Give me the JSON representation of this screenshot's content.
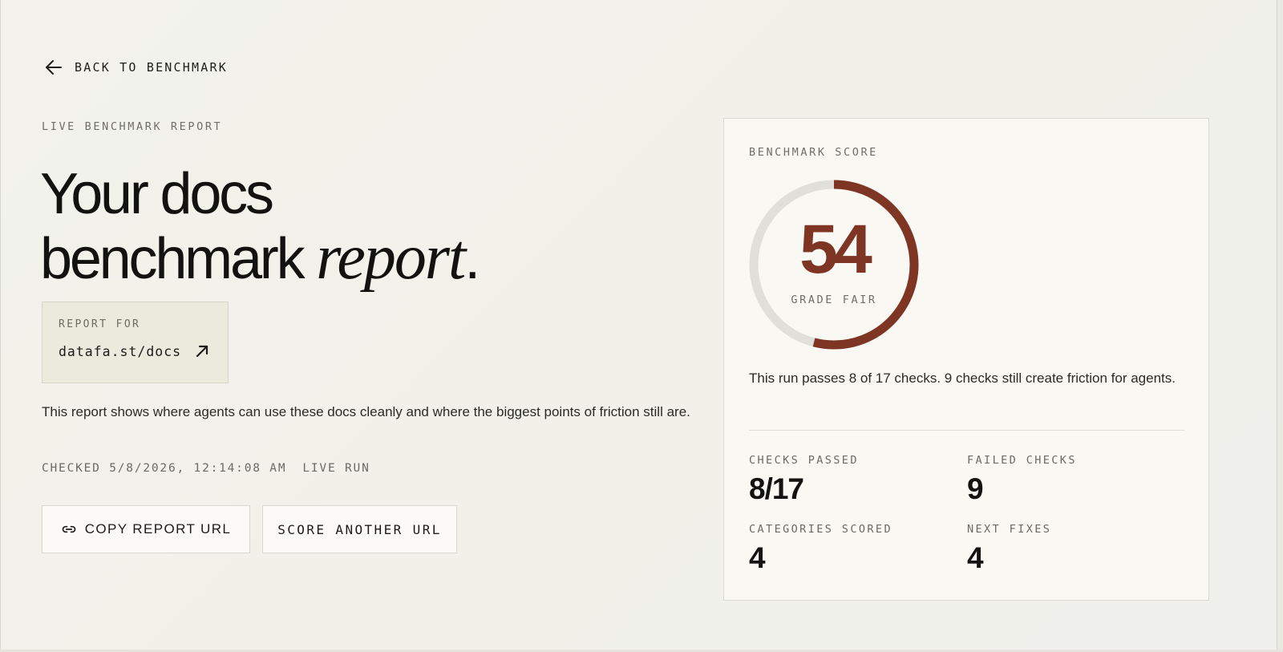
{
  "nav": {
    "back_label": "BACK TO BENCHMARK"
  },
  "hero": {
    "eyebrow": "LIVE BENCHMARK REPORT",
    "title_line1": "Your docs",
    "title_line2": "benchmark",
    "title_italic": "report",
    "title_end": "."
  },
  "report_for": {
    "label": "REPORT FOR",
    "url": "datafa.st/docs"
  },
  "description": "This report shows where agents can use these docs cleanly and where the biggest points of friction still are.",
  "meta": {
    "checked": "CHECKED 5/8/2026, 12:14:08 AM",
    "run_type": "LIVE RUN"
  },
  "actions": {
    "copy_label": "COPY REPORT URL",
    "score_label": "SCORE ANOTHER URL"
  },
  "score_card": {
    "eyebrow": "BENCHMARK SCORE",
    "score": "54",
    "score_fraction": 0.54,
    "grade": "GRADE FAIR",
    "summary": "This run passes 8 of 17 checks. 9 checks still create friction for agents.",
    "stats": [
      {
        "label": "CHECKS PASSED",
        "value": "8/17"
      },
      {
        "label": "FAILED CHECKS",
        "value": "9"
      },
      {
        "label": "CATEGORIES SCORED",
        "value": "4"
      },
      {
        "label": "NEXT FIXES",
        "value": "4"
      }
    ]
  },
  "colors": {
    "accent": "#7e3524",
    "track": "#e0dfda",
    "report_box": "#ece9dd",
    "card": "#f9f8f3"
  },
  "icons": {
    "back": "arrow-left-icon",
    "external": "arrow-up-right-icon",
    "copy": "link-icon"
  }
}
